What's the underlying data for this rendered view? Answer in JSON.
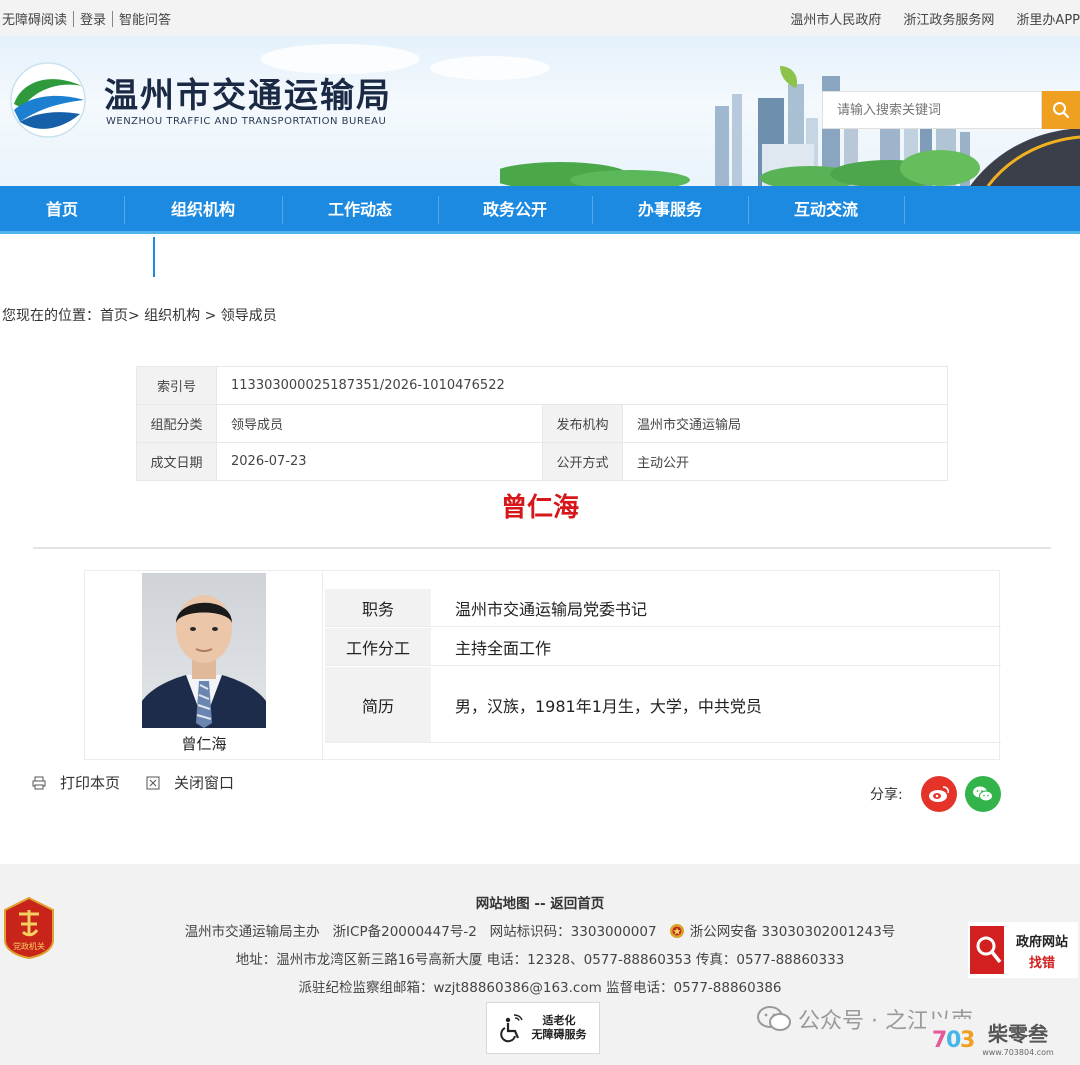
{
  "topbar": {
    "left": [
      "无障碍阅读",
      "登录",
      "智能问答"
    ],
    "right": [
      "温州市人民政府",
      "浙江政务服务网",
      "浙里办APP"
    ]
  },
  "header": {
    "title": "温州市交通运输局",
    "subtitle": "WENZHOU TRAFFIC AND TRANSPORTATION BUREAU",
    "search_placeholder": "请输入搜索关键词"
  },
  "nav": [
    "首页",
    "组织机构",
    "工作动态",
    "政务公开",
    "办事服务",
    "互动交流"
  ],
  "breadcrumb": "您现在的位置：首页> 组织机构 > 领导成员",
  "meta": {
    "index_label": "索引号",
    "index_value": "113303000025187351/2026-1010476522",
    "category_label": "组配分类",
    "category_value": "领导成员",
    "publisher_label": "发布机构",
    "publisher_value": "温州市交通运输局",
    "date_label": "成文日期",
    "date_value": "2026-07-23",
    "open_label": "公开方式",
    "open_value": "主动公开"
  },
  "person": {
    "name": "曾仁海",
    "photo_caption": "曾仁海",
    "rows": [
      {
        "label": "职务",
        "value": "温州市交通运输局党委书记"
      },
      {
        "label": "工作分工",
        "value": "主持全面工作"
      },
      {
        "label": "简历",
        "value": "男，汉族，1981年1月生，大学，中共党员"
      }
    ]
  },
  "actions": {
    "print": "打印本页",
    "close": "关闭窗口",
    "share": "分享:"
  },
  "footer": {
    "links": "网站地图 -- 返回首页",
    "line1_a": "温州市交通运输局主办",
    "line1_b": "浙ICP备20000447号-2",
    "line1_c": "网站标识码：3303000007",
    "line1_d": "浙公网安备 33030302001243号",
    "line2": "地址：温州市龙湾区新三路16号高新大厦 电话：12328、0577-88860353 传真：0577-88860333",
    "line3": "派驻纪检监察组邮箱：wzjt88860386@163.com 监督电话：0577-88860386",
    "party_badge": "党政机关",
    "gov_err_top": "政府网站",
    "gov_err_bottom": "找错",
    "elder_line1": "适老化",
    "elder_line2": "无障碍服务"
  },
  "watermark": {
    "text": "公众号 · 之江以南",
    "logo_text": "柴零叁",
    "logo_url": "www.703804.com"
  },
  "colors": {
    "nav": "#1b8ae0",
    "accent_orange": "#f0a020",
    "name_red": "#d7161a",
    "weibo": "#e5332a",
    "wechat": "#32b44a"
  }
}
